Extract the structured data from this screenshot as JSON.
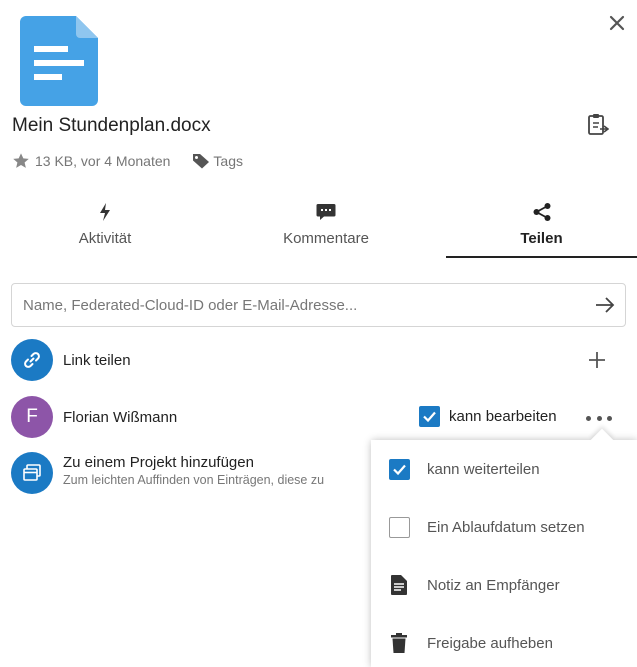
{
  "file": {
    "name": "Mein Stundenplan.docx",
    "size_age": "13 KB, vor 4 Monaten",
    "tags_label": "Tags",
    "accent_color": "#45a2e6"
  },
  "tabs": [
    {
      "label": "Aktivität",
      "icon": "lightning-icon"
    },
    {
      "label": "Kommentare",
      "icon": "comment-icon"
    },
    {
      "label": "Teilen",
      "icon": "share-icon",
      "active": true
    }
  ],
  "share_search": {
    "placeholder": "Name, Federated-Cloud-ID oder E-Mail-Adresse..."
  },
  "link_share": {
    "label": "Link teilen"
  },
  "sharee": {
    "avatar_initial": "F",
    "name": "Florian Wißmann",
    "permission_label": "kann bearbeiten",
    "permission_checked": true
  },
  "project": {
    "title": "Zu einem Projekt hinzufügen",
    "subtitle": "Zum leichten Auffinden von Einträgen, diese zu"
  },
  "menu": {
    "items": [
      {
        "label": "kann weiterteilen",
        "type": "checkbox",
        "checked": true
      },
      {
        "label": "Ein Ablaufdatum setzen",
        "type": "checkbox",
        "checked": false
      },
      {
        "label": "Notiz an Empfänger",
        "type": "action",
        "icon": "note-icon"
      },
      {
        "label": "Freigabe aufheben",
        "type": "action",
        "icon": "trash-icon"
      }
    ]
  },
  "colors": {
    "primary_blue": "#1b7ac4",
    "avatar_purple": "#8d55a8"
  }
}
